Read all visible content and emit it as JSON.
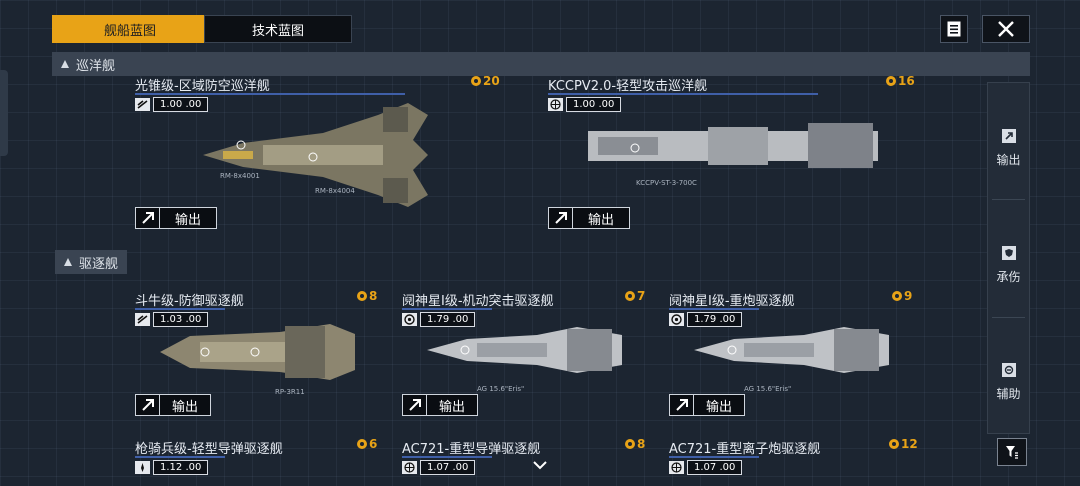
{
  "tabs": [
    {
      "label": "舰船蓝图",
      "active": true
    },
    {
      "label": "技术蓝图",
      "active": false
    }
  ],
  "sections": {
    "cruiser": "巡洋舰",
    "destroyer": "驱逐舰"
  },
  "cards": [
    {
      "title": "光锥级-区域防空巡洋舰",
      "rating": "1.00 .00",
      "count": "20",
      "export_label": "输出",
      "tag1": "RM-8x4001",
      "tag2": "RM-8x4004"
    },
    {
      "title": "KCCPV2.0-轻型攻击巡洋舰",
      "rating": "1.00 .00",
      "count": "16",
      "export_label": "输出",
      "tag1": "KCCPV-ST-3-700C"
    },
    {
      "title": "斗牛级-防御驱逐舰",
      "rating": "1.03 .00",
      "count": "8",
      "export_label": "输出",
      "tag1": "RP-3R11"
    },
    {
      "title": "阋神星I级-机动突击驱逐舰",
      "rating": "1.79 .00",
      "count": "7",
      "export_label": "输出",
      "tag1": "AG 15.6\"Eris\""
    },
    {
      "title": "阋神星I级-重炮驱逐舰",
      "rating": "1.79 .00",
      "count": "9",
      "export_label": "输出",
      "tag1": "AG 15.6\"Eris\""
    },
    {
      "title": "枪骑兵级-轻型导弹驱逐舰",
      "rating": "1.12 .00",
      "count": "6"
    },
    {
      "title": "AC721-重型导弹驱逐舰",
      "rating": "1.07 .00",
      "count": "8"
    },
    {
      "title": "AC721-重型离子炮驱逐舰",
      "rating": "1.07 .00",
      "count": "12"
    }
  ],
  "right_bar": {
    "items": [
      {
        "label": "输出",
        "icon": "arrow-icon"
      },
      {
        "label": "承伤",
        "icon": "shield-icon"
      },
      {
        "label": "辅助",
        "icon": "support-icon"
      }
    ]
  },
  "colors": {
    "accent": "#e8a317",
    "panel": "#3a4452",
    "title_line": "#3f5fa8"
  }
}
